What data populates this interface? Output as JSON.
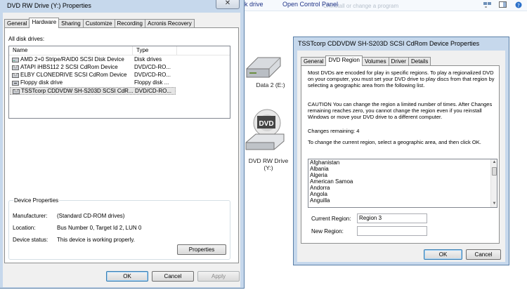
{
  "explorer": {
    "toolbar": {
      "ghost_text": "Uninstall or change a program",
      "burn": "ork drive",
      "control_panel": "Open Control Panel"
    },
    "drives": [
      {
        "label": "Data 2 (E:)"
      },
      {
        "label": "DVD RW Drive\n(Y:)",
        "icon_text": "DVD"
      }
    ]
  },
  "props_window": {
    "title": "DVD RW Drive (Y:) Properties",
    "close": "✕",
    "tabs": [
      "General",
      "Hardware",
      "Sharing",
      "Customize",
      "Recording",
      "Acronis Recovery"
    ],
    "active_tab": "Hardware",
    "all_drives_label": "All disk drives:",
    "columns": {
      "name": "Name",
      "type": "Type"
    },
    "drives": [
      {
        "name": "AMD 2+0 Stripe/RAID0 SCSI Disk Device",
        "type": "Disk drives"
      },
      {
        "name": "ATAPI iHBS112   2 SCSI CdRom Device",
        "type": "DVD/CD-RO..."
      },
      {
        "name": "ELBY CLONEDRIVE SCSI CdRom Device",
        "type": "DVD/CD-RO..."
      },
      {
        "name": "Floppy disk drive",
        "type": "Floppy disk ..."
      },
      {
        "name": "TSSTcorp CDDVDW SH-S203D SCSI CdR...",
        "type": "DVD/CD-RO..."
      }
    ],
    "device_properties": {
      "title": "Device Properties",
      "manufacturer_label": "Manufacturer:",
      "manufacturer": "(Standard CD-ROM drives)",
      "location_label": "Location:",
      "location": "Bus Number 0, Target Id 2, LUN 0",
      "status_label": "Device status:",
      "status": "This device is working properly.",
      "properties_button": "Properties"
    },
    "buttons": {
      "ok": "OK",
      "cancel": "Cancel",
      "apply": "Apply"
    }
  },
  "device_window": {
    "title": "TSSTcorp CDDVDW SH-S203D SCSI CdRom Device Properties",
    "tabs": [
      "General",
      "DVD Region",
      "Volumes",
      "Driver",
      "Details"
    ],
    "active_tab": "DVD Region",
    "intro": "Most DVDs are encoded for play in specific regions. To play a regionalized DVD on your computer, you must set your DVD drive to play discs from that region by selecting a geographic area from the following list.",
    "caution": "CAUTION   You can change the region a limited number of times. After Changes remaining reaches zero, you cannot change the region even if you reinstall Windows or move your DVD drive to a different computer.",
    "changes_remaining": "Changes remaining: 4",
    "instruction": "To change the current region, select a geographic area, and then click OK.",
    "regions": [
      "Afghanistan",
      "Albania",
      "Algeria",
      "American Samoa",
      "Andorra",
      "Angola",
      "Anguilla"
    ],
    "current_region_label": "Current Region:",
    "current_region": "Region 3",
    "new_region_label": "New Region:",
    "new_region": "",
    "buttons": {
      "ok": "OK",
      "cancel": "Cancel"
    }
  },
  "colors": {
    "selection": "#e5e5e5",
    "frame": "#c6d8ec",
    "link": "#1e3287"
  }
}
